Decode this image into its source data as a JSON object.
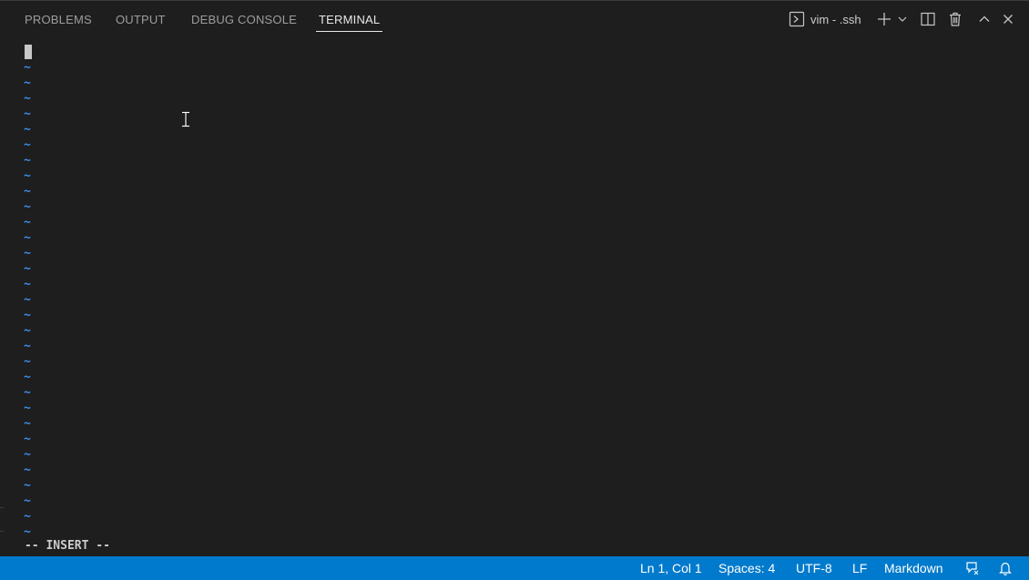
{
  "panel": {
    "tabs": [
      {
        "label": "PROBLEMS",
        "active": false
      },
      {
        "label": "OUTPUT",
        "active": false
      },
      {
        "label": "DEBUG CONSOLE",
        "active": false
      },
      {
        "label": "TERMINAL",
        "active": true
      }
    ],
    "toolbar": {
      "terminal_name": "vim - .ssh",
      "terminal_icon": "terminal-icon",
      "icons": [
        "plus-icon",
        "chevron-down-icon",
        "split-icon",
        "trash-icon",
        "chevron-up-icon",
        "close-icon"
      ]
    }
  },
  "terminal": {
    "tilde": "~",
    "mode": "-- INSERT --",
    "tilde_color": "#3b8eea",
    "background": "#1e1e1e"
  },
  "statusbar": {
    "background": "#007acc",
    "position": "Ln 1, Col 1",
    "spaces": "Spaces: 4",
    "encoding": "UTF-8",
    "eol": "LF",
    "language": "Markdown",
    "icons": [
      "feedback-icon",
      "bell-icon"
    ]
  }
}
